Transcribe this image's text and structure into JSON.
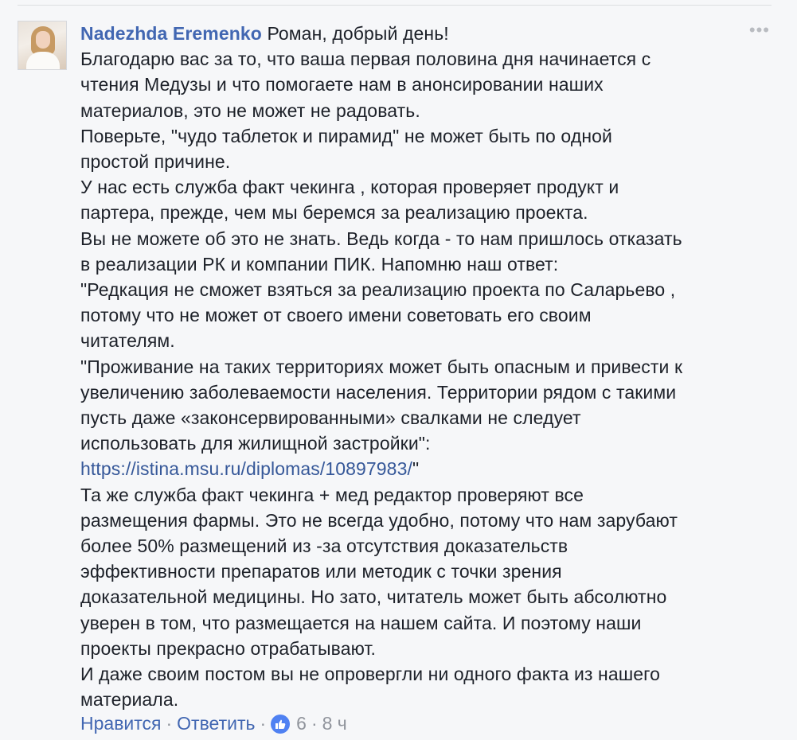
{
  "comment": {
    "author": "Nadezhda Eremenko",
    "lines": [
      "Роман, добрый день!",
      "Благодарю вас за то, что ваша первая половина дня начинается с",
      "чтения Медузы и что помогаете нам в анонсировании наших",
      "материалов, это не может не радовать.",
      "Поверьте, \"чудо таблеток и пирамид\" не может быть по одной",
      "простой причине.",
      "У нас есть служба факт чекинга , которая проверяет продукт и",
      "партера, прежде, чем мы беремся за реализацию проекта.",
      "Вы не можете об это не знать. Ведь когда - то нам пришлось отказать",
      "в реализации РК и компании ПИК. Напомню наш ответ:",
      "\"Редкация не сможет взяться за реализацию проекта по Саларьево ,",
      "потому что не может от своего имени советовать его своим",
      "читателям.",
      "\"Проживание на таких территориях может быть опасным и привести к",
      "увеличению заболеваемости населения. Территории рядом с такими",
      "пусть даже «законсервированными» свалками не следует",
      "использовать для жилищной застройки\":",
      "https://istina.msu.ru/diplomas/10897983/",
      "\"",
      "Та же служба факт чекинга + мед редактор проверяют все",
      "размещения фармы. Это не всегда удобно, потому что нам зарубают",
      "более 50% размещений из -за отсутствия доказательств",
      "эффективности препаратов или методик с точки зрения",
      "доказательной медицины. Но зато, читатель может быть абсолютно",
      "уверен в том, что размещается на нашем сайта. И поэтому наши",
      "проекты прекрасно отрабатывают.",
      "И даже своим постом вы не опровергли ни одного факта из нашего",
      "материала."
    ]
  },
  "actions": {
    "like_label": "Нравится",
    "reply_label": "Ответить",
    "like_count": "6",
    "time": "8 ч",
    "separator": "·"
  },
  "icons": {
    "options": "more-options-icon",
    "like": "thumbs-up-icon"
  },
  "colors": {
    "author": "#4267b2",
    "link": "#365899",
    "meta": "#90949c",
    "like_badge": "#4f81f2",
    "background": "#f6f7f9"
  }
}
